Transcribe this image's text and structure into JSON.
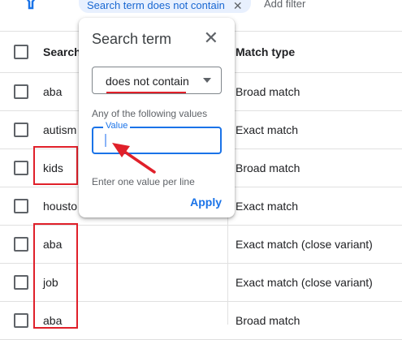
{
  "filter_bar": {
    "chip_label": "Search term does not contain",
    "chip_close": "✕",
    "add_filter": "Add filter"
  },
  "table": {
    "columns": {
      "search": "Search",
      "match_type": "Match type"
    },
    "rows": [
      {
        "term": "aba",
        "match": "Broad match"
      },
      {
        "term": "autism",
        "match": "Exact match"
      },
      {
        "term": "kids",
        "match": "Broad match"
      },
      {
        "term": "housto",
        "match": "Exact match"
      },
      {
        "term": "aba",
        "match": "Exact match (close variant)"
      },
      {
        "term": "job",
        "match": "Exact match (close variant)"
      },
      {
        "term": "aba",
        "match": "Broad match"
      }
    ]
  },
  "popup": {
    "title": "Search term",
    "close": "✕",
    "operator_selected": "does not contain",
    "values_label": "Any of the following values",
    "value_field_label": "Value",
    "value_field_value": "",
    "hint": "Enter one value per line",
    "apply_label": "Apply"
  },
  "colors": {
    "accent": "#1a73e8",
    "annotation_red": "#e0202a",
    "chip_bg": "#e8f0fe"
  }
}
